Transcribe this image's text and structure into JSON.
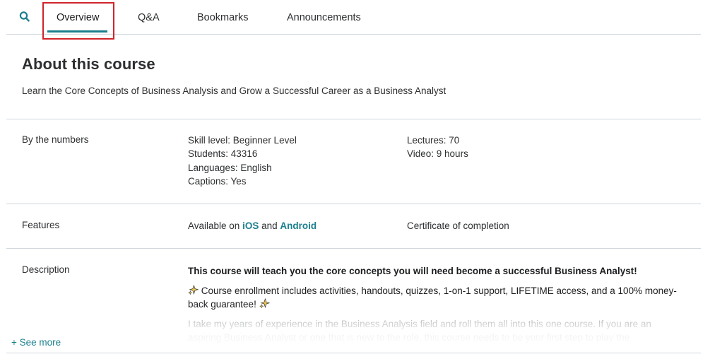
{
  "tabs": {
    "items": [
      {
        "label": "Overview"
      },
      {
        "label": "Q&A"
      },
      {
        "label": "Bookmarks"
      },
      {
        "label": "Announcements"
      }
    ],
    "active": "Overview"
  },
  "about": {
    "title": "About this course",
    "subtitle": "Learn the Core Concepts of Business Analysis and Grow a Successful Career as a Business Analyst"
  },
  "numbers": {
    "label": "By the numbers",
    "skill_level": "Skill level: Beginner Level",
    "students": "Students: 43316",
    "languages": "Languages: English",
    "captions": "Captions: Yes",
    "lectures": "Lectures: 70",
    "video": "Video: 9 hours"
  },
  "features": {
    "label": "Features",
    "available_prefix": "Available on ",
    "ios": "iOS",
    "and": " and ",
    "android": "Android",
    "certificate": "Certificate of completion"
  },
  "description": {
    "label": "Description",
    "headline": "This course will teach you the core concepts you will need become a successful Business Analyst!",
    "enrollment": "Course enrollment includes activities, handouts, quizzes, 1-on-1 support, LIFETIME access, and a 100% money-back guarantee!",
    "body": "I take my years of experience in the Business Analysis field and roll them all into this one course.  If you are an aspiring Business Analyst or one that is new to the role, this course needs to be your first step to play the"
  },
  "see_more": "+ See more",
  "colors": {
    "accent": "#1a7f8e",
    "highlight": "#d1232a",
    "text": "#2d2f31",
    "divider": "#d1d7dc"
  },
  "icons": {
    "search": "search-icon",
    "sparkle": "sparkle-icon"
  }
}
